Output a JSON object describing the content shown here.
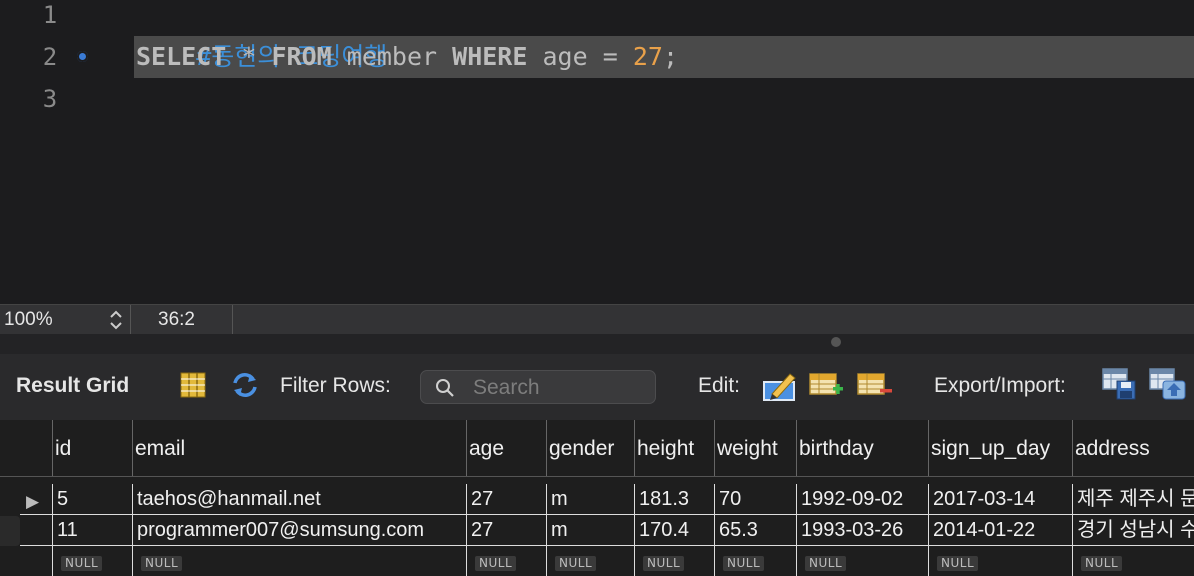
{
  "editor": {
    "line_numbers": [
      "1",
      "2",
      "3"
    ],
    "comment": "#동현의 코딩여행",
    "query": {
      "select": "SELECT",
      "star": "*",
      "from": "FROM",
      "table": "member",
      "where": "WHERE",
      "column": "age",
      "op": "=",
      "value": "27",
      "semicolon": ";"
    }
  },
  "status_bar": {
    "zoom": "100%",
    "cursor_position": "36:2"
  },
  "toolbar": {
    "result_grid_label": "Result Grid",
    "filter_rows_label": "Filter Rows:",
    "search_placeholder": "Search",
    "edit_label": "Edit:",
    "export_import_label": "Export/Import:"
  },
  "grid": {
    "columns": [
      "id",
      "email",
      "age",
      "gender",
      "height",
      "weight",
      "birthday",
      "sign_up_day",
      "address"
    ],
    "rows": [
      [
        "5",
        "taehos@hanmail.net",
        "27",
        "m",
        "181.3",
        "70",
        "1992-09-02",
        "2017-03-14",
        "제주 제주시 문"
      ],
      [
        "11",
        "programmer007@sumsung.com",
        "27",
        "m",
        "170.4",
        "65.3",
        "1993-03-26",
        "2014-01-22",
        "경기 성남시 수"
      ]
    ],
    "null_label": "NULL",
    "selected_row_marker": "▶"
  },
  "colors": {
    "comment": "#3b8fd9",
    "number": "#e9a14a",
    "keyword": "#bcbcbc",
    "breakpoint": "#3a7bd5"
  }
}
